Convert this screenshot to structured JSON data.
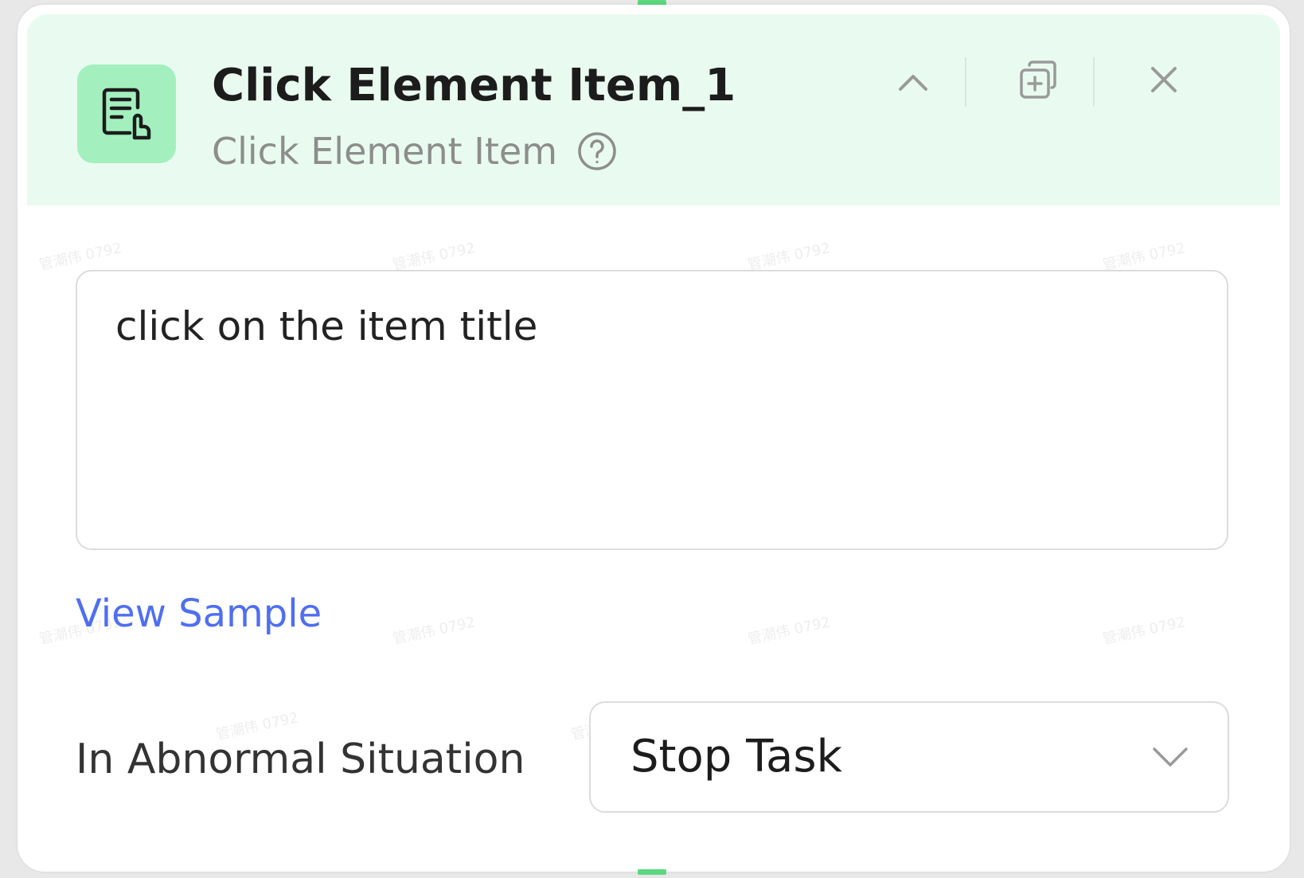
{
  "node": {
    "title": "Click Element Item_1",
    "subtitle": "Click Element Item",
    "icon": "click-document-icon",
    "header_color": "#e9fbf0",
    "icon_bg_color": "#a3f0be"
  },
  "header_actions": {
    "collapse_icon": "chevron-up-icon",
    "duplicate_icon": "duplicate-icon",
    "close_icon": "close-icon"
  },
  "prompt": {
    "value": "click on the item title"
  },
  "view_sample_label": "View Sample",
  "abnormal": {
    "label": "In Abnormal Situation",
    "selected": "Stop Task"
  },
  "watermark_text": "管潮伟 0792",
  "colors": {
    "accent_link": "#4f6ef2",
    "connector": "#5cd77f"
  }
}
